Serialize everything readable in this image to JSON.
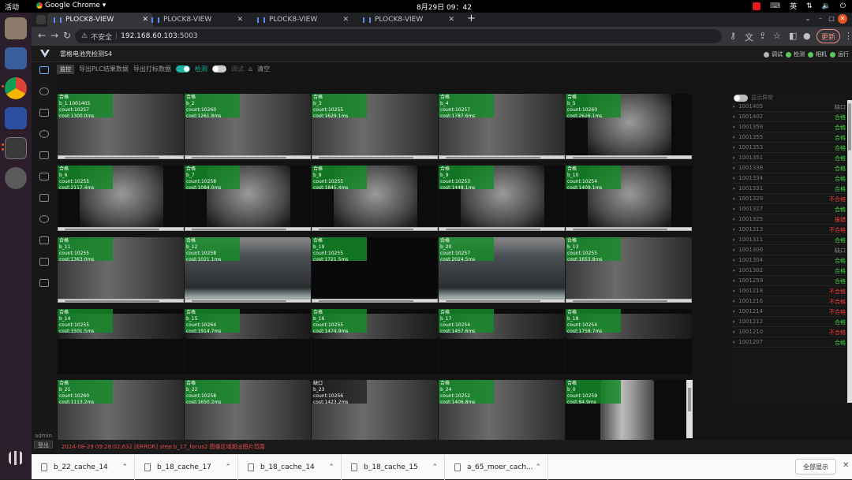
{
  "system": {
    "activities": "活动",
    "app": "Google Chrome ▾",
    "clock": "8月29日 09：42",
    "lang": "英"
  },
  "browser": {
    "tabs": [
      "PLOCK8-VIEW",
      "PLOCK8-VIEW",
      "PLOCK8-VIEW",
      "PLOCK8-VIEW"
    ],
    "insecure": "不安全",
    "url_host": "192.168.60.103",
    "url_port": ":5003",
    "update": "更新"
  },
  "app": {
    "title": "雷格电池壳检测S4",
    "status": [
      {
        "label": "调试",
        "color": "#b5b5b5"
      },
      {
        "label": "检测",
        "color": "#5ac85a"
      },
      {
        "label": "相机",
        "color": "#5ac85a"
      },
      {
        "label": "运行",
        "color": "#5ac85a"
      }
    ],
    "toolbar": {
      "monitor": "监控",
      "export_plc": "导出PLC结果数据",
      "export_print": "导出打标数据",
      "detect": "检测",
      "debug": "调试",
      "clear": "清空"
    },
    "admin": "admin",
    "logout": "登出",
    "list_title": "显示异常",
    "log": "2024-08-29 09:28:02,632 [ERROR] step:b_17_focus2 图像区域超出图片范围",
    "cells": [
      {
        "r": "合格",
        "n": "b_1 1001405",
        "c": "count:10257 cost:1300.0ms"
      },
      {
        "r": "合格",
        "n": "b_2",
        "c": "count:10260 cost:1261.8ms"
      },
      {
        "r": "合格",
        "n": "b_3",
        "c": "count:10255 cost:1629.1ms"
      },
      {
        "r": "合格",
        "n": "b_4",
        "c": "count:10257 cost:1787.6ms"
      },
      {
        "r": "合格",
        "n": "b_5",
        "c": "count:10260 cost:2626.1ms"
      },
      {
        "r": "合格",
        "n": "b_6",
        "c": "count:10255 cost:2117.4ms"
      },
      {
        "r": "合格",
        "n": "b_7",
        "c": "count:10258 cost:1084.0ms"
      },
      {
        "r": "合格",
        "n": "b_8",
        "c": "count:10255 cost:1845.4ms"
      },
      {
        "r": "合格",
        "n": "b_9",
        "c": "count:10253 cost:1448.1ms"
      },
      {
        "r": "合格",
        "n": "b_10",
        "c": "count:10254 cost:1409.1ms"
      },
      {
        "r": "合格",
        "n": "b_11",
        "c": "count:10255 cost:1363.0ms"
      },
      {
        "r": "合格",
        "n": "b_12",
        "c": "count:10258 cost:1021.1ms"
      },
      {
        "r": "合格",
        "n": "b_19",
        "c": "count:10255 cost:1721.5ms"
      },
      {
        "r": "合格",
        "n": "b_20",
        "c": "count:10257 cost:2024.5ms"
      },
      {
        "r": "合格",
        "n": "b_13",
        "c": "count:10255 cost:1653.8ms"
      },
      {
        "r": "合格",
        "n": "b_14",
        "c": "count:10255 cost:1501.5ms"
      },
      {
        "r": "合格",
        "n": "b_15",
        "c": "count:10264 cost:1914.7ms"
      },
      {
        "r": "合格",
        "n": "b_16",
        "c": "count:10255 cost:1474.9ms"
      },
      {
        "r": "合格",
        "n": "b_17",
        "c": "count:10254 cost:1457.6ms"
      },
      {
        "r": "合格",
        "n": "b_18",
        "c": "count:10254 cost:1758.7ms"
      },
      {
        "r": "合格",
        "n": "b_21",
        "c": "count:10260 cost:1113.2ms"
      },
      {
        "r": "合格",
        "n": "b_22",
        "c": "count:10258 cost:1650.2ms"
      },
      {
        "r": "缺口",
        "n": "b_23",
        "c": "count:10256 cost:1423.2ms"
      },
      {
        "r": "合格",
        "n": "b_24",
        "c": "count:10252 cost:1406.8ms"
      },
      {
        "r": "合格",
        "n": "b_0",
        "c": "count:10259 cost:84.9ms"
      }
    ],
    "results": [
      {
        "id": "1001405",
        "s": "缺口",
        "col": "#888"
      },
      {
        "id": "1001402",
        "s": "合格",
        "col": "#3ddc3d"
      },
      {
        "id": "1001358",
        "s": "合格",
        "col": "#3ddc3d"
      },
      {
        "id": "1001355",
        "s": "合格",
        "col": "#3ddc3d"
      },
      {
        "id": "1001353",
        "s": "合格",
        "col": "#3ddc3d"
      },
      {
        "id": "1001351",
        "s": "合格",
        "col": "#3ddc3d"
      },
      {
        "id": "1001336",
        "s": "合格",
        "col": "#3ddc3d"
      },
      {
        "id": "1001334",
        "s": "合格",
        "col": "#3ddc3d"
      },
      {
        "id": "1001331",
        "s": "合格",
        "col": "#3ddc3d"
      },
      {
        "id": "1001329",
        "s": "不合格",
        "col": "#ff3b3b"
      },
      {
        "id": "1001327",
        "s": "合格",
        "col": "#3ddc3d"
      },
      {
        "id": "1001325",
        "s": "报错",
        "col": "#ff3b3b"
      },
      {
        "id": "1001313",
        "s": "不合格",
        "col": "#ff3b3b"
      },
      {
        "id": "1001311",
        "s": "合格",
        "col": "#3ddc3d"
      },
      {
        "id": "1001306",
        "s": "缺口",
        "col": "#888"
      },
      {
        "id": "1001304",
        "s": "合格",
        "col": "#3ddc3d"
      },
      {
        "id": "1001302",
        "s": "合格",
        "col": "#3ddc3d"
      },
      {
        "id": "1001259",
        "s": "合格",
        "col": "#3ddc3d"
      },
      {
        "id": "1001218",
        "s": "不合格",
        "col": "#ff3b3b"
      },
      {
        "id": "1001216",
        "s": "不合格",
        "col": "#ff3b3b"
      },
      {
        "id": "1001214",
        "s": "不合格",
        "col": "#ff3b3b"
      },
      {
        "id": "1001212",
        "s": "合格",
        "col": "#3ddc3d"
      },
      {
        "id": "1001210",
        "s": "不合格",
        "col": "#ff3b3b"
      },
      {
        "id": "1001207",
        "s": "合格",
        "col": "#3ddc3d"
      }
    ]
  },
  "downloads": {
    "items": [
      "b_22_cache_14",
      "b_18_cache_17",
      "b_18_cache_14",
      "b_18_cache_15",
      "a_65_moer_cach..."
    ],
    "show_all": "全部显示"
  }
}
